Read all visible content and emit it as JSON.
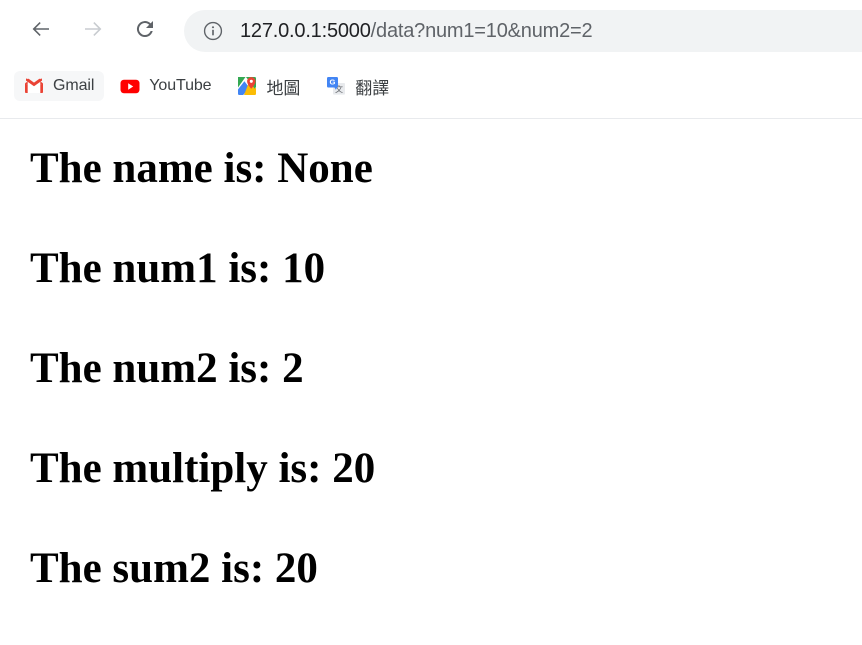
{
  "browser": {
    "nav": {
      "back_label": "Back",
      "back_icon": "arrow-left-icon",
      "forward_label": "Forward",
      "forward_icon": "arrow-right-icon",
      "reload_label": "Reload",
      "reload_icon": "reload-icon"
    },
    "omnibox": {
      "site_info_icon": "info-circle-icon",
      "url_host": "127.0.0.1:5000",
      "url_rest": "/data?num1=10&num2=2",
      "url_full": "127.0.0.1:5000/data?num1=10&num2=2"
    },
    "bookmarks": [
      {
        "label": "Gmail",
        "icon": "gmail-icon"
      },
      {
        "label": "YouTube",
        "icon": "youtube-icon"
      },
      {
        "label": "地圖",
        "icon": "google-maps-icon"
      },
      {
        "label": "翻譯",
        "icon": "google-translate-icon"
      }
    ]
  },
  "page": {
    "lines": [
      {
        "text": "The name is: None"
      },
      {
        "text": "The num1 is: 10"
      },
      {
        "text": "The num2 is: 2"
      },
      {
        "text": "The multiply is: 20"
      },
      {
        "text": "The sum2 is: 20"
      }
    ]
  },
  "colors": {
    "omnibox_bg": "#f1f3f4",
    "url_host": "#202124",
    "url_rest": "#5f6368",
    "text": "#000000",
    "gmail_red": "#ea4335",
    "youtube_red": "#ff0000",
    "maps_green": "#34a853",
    "translate_blue": "#4285f4"
  }
}
